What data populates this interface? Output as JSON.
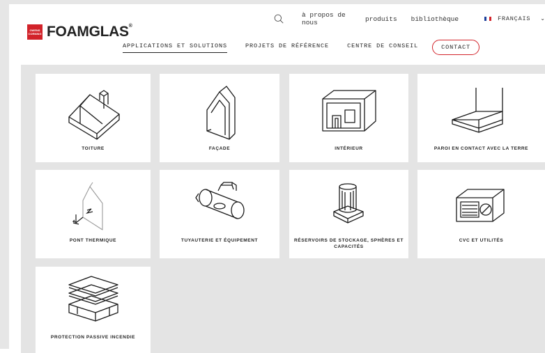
{
  "header": {
    "brand": "FOAMGLAS",
    "brand_reg": "®",
    "badge_text": "OWENS CORNING",
    "utility_links": [
      "à propos de nous",
      "produits",
      "bibliothèque"
    ],
    "language": "FRANÇAIS",
    "language_flag_colors": [
      "#1d3f9a",
      "#ffffff",
      "#d2232a"
    ],
    "nav": [
      {
        "label": "APPLICATIONS ET SOLUTIONS",
        "active": true
      },
      {
        "label": "PROJETS DE RÉFÉRENCE"
      },
      {
        "label": "CENTRE DE CONSEIL"
      }
    ],
    "contact_label": "CONTACT"
  },
  "colors": {
    "accent": "#d2232a",
    "panel_bg": "#e4e4e4"
  },
  "tiles": [
    {
      "label": "TOITURE",
      "icon": "roof-icon"
    },
    {
      "label": "FAÇADE",
      "icon": "facade-icon"
    },
    {
      "label": "INTÉRIEUR",
      "icon": "interior-icon"
    },
    {
      "label": "PAROI EN CONTACT AVEC LA TERRE",
      "icon": "ground-wall-icon"
    },
    {
      "label": "PONT THERMIQUE",
      "icon": "thermal-bridge-icon"
    },
    {
      "label": "TUYAUTERIE ET ÉQUIPEMENT",
      "icon": "piping-icon"
    },
    {
      "label": "RÉSERVOIRS DE STOCKAGE, SPHÈRES ET CAPACITÉS",
      "icon": "storage-tank-icon"
    },
    {
      "label": "CVC ET UTILITÉS",
      "icon": "hvac-icon"
    },
    {
      "label": "PROTECTION PASSIVE INCENDIE",
      "icon": "fire-protection-icon"
    }
  ]
}
